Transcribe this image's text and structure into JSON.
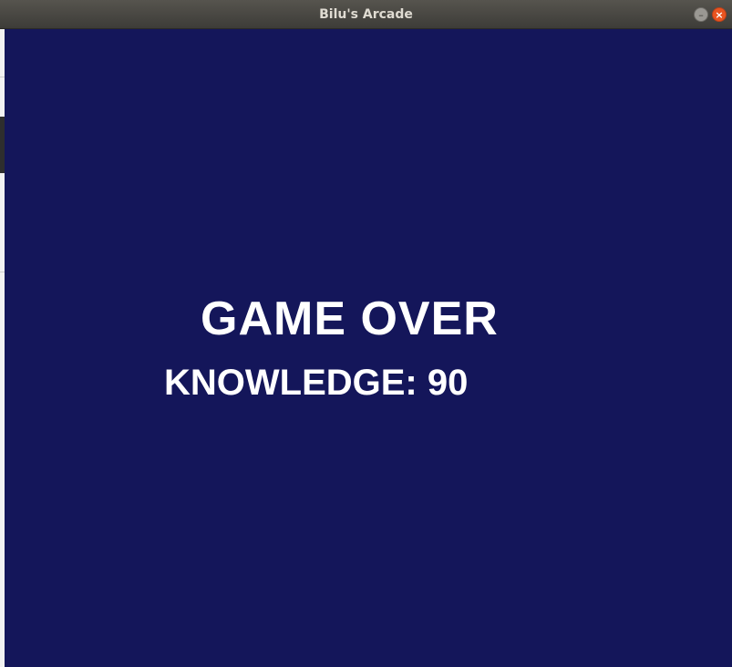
{
  "window": {
    "title": "Bilu's Arcade",
    "minimize_glyph": "–",
    "close_glyph": "×",
    "minimize_icon": "minimize-icon",
    "close_icon": "close-icon"
  },
  "game": {
    "background_color": "#14165a",
    "text_color": "#ffffff",
    "heading": "GAME OVER",
    "score_label": "KNOWLEDGE:",
    "score_value": "90"
  }
}
